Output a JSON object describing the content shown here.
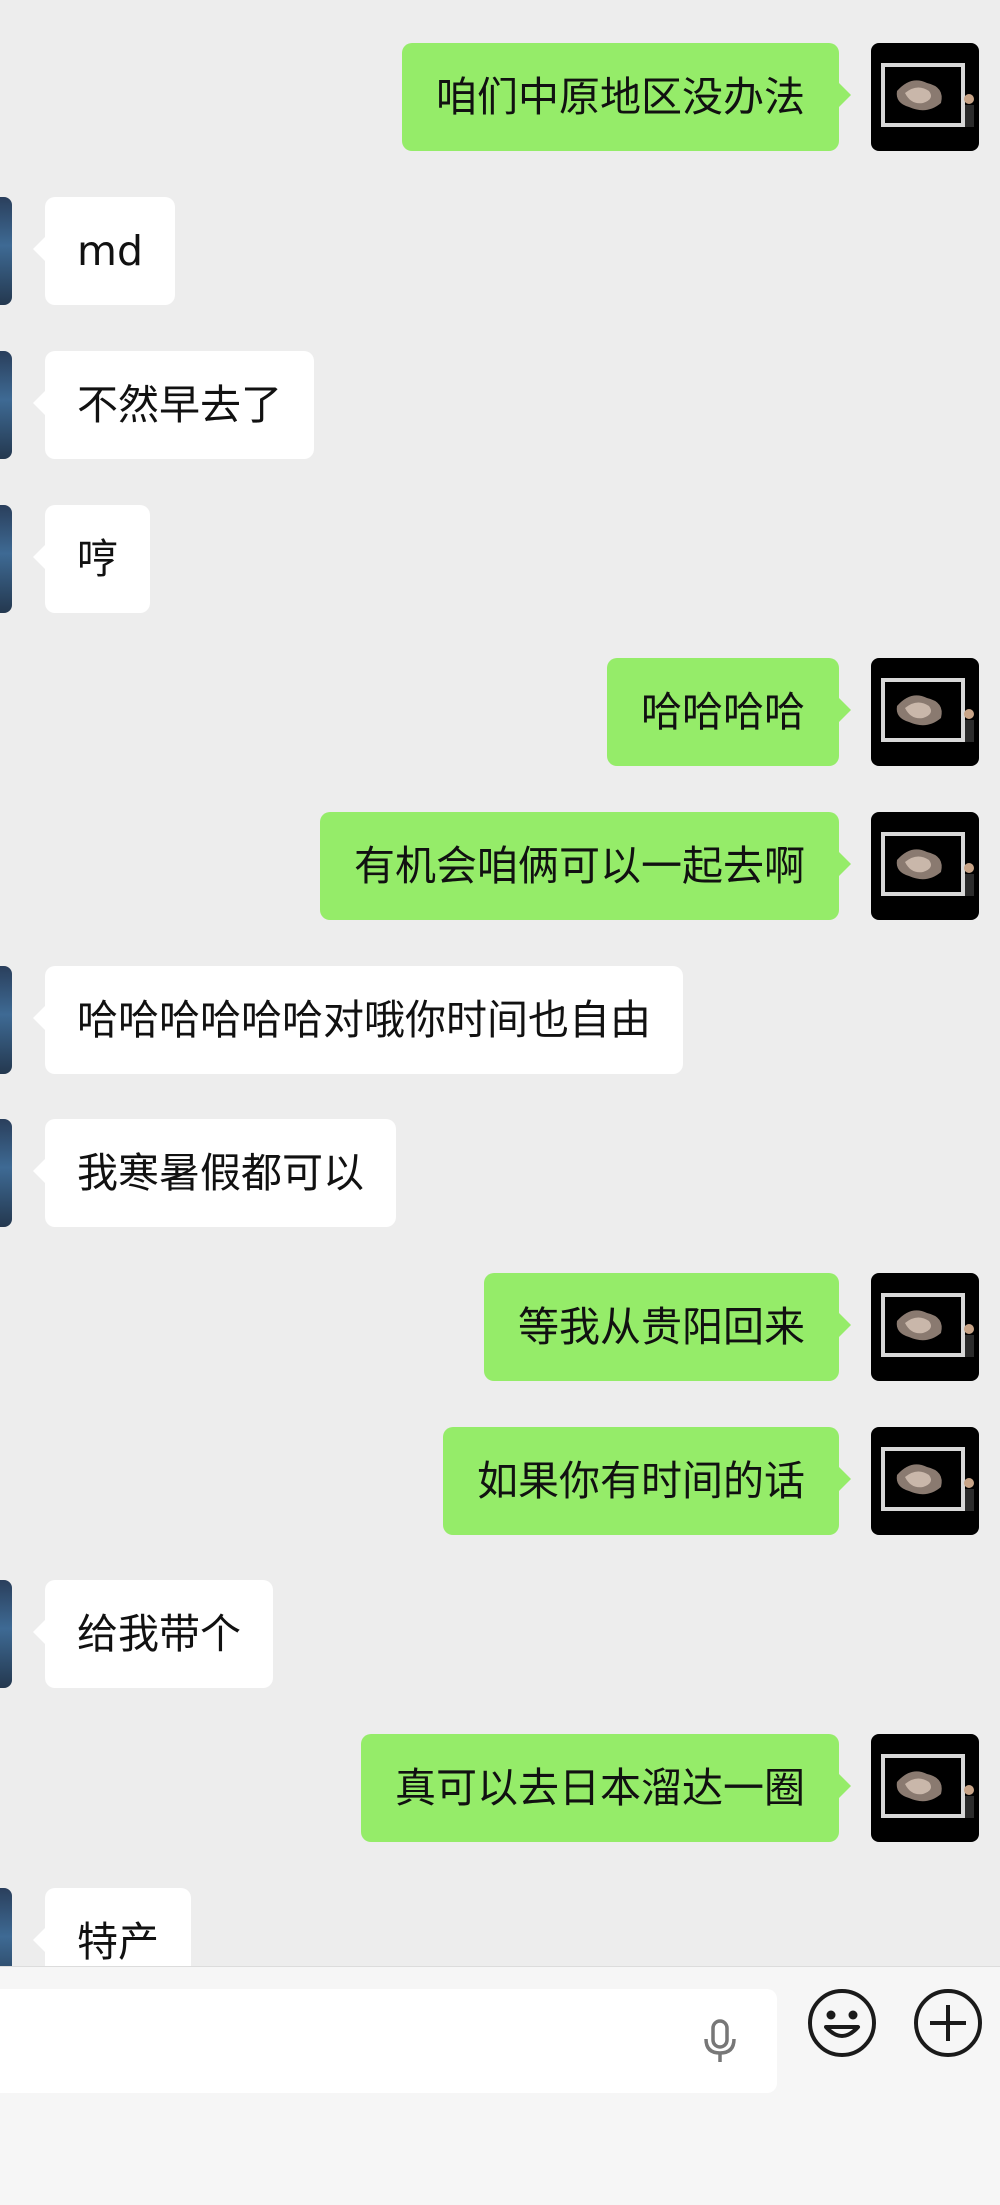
{
  "messages": [
    {
      "side": "out",
      "text": "咱们中原地区没办法"
    },
    {
      "side": "in",
      "text": "md"
    },
    {
      "side": "in",
      "text": "不然早去了"
    },
    {
      "side": "in",
      "text": "哼"
    },
    {
      "side": "out",
      "text": "哈哈哈哈"
    },
    {
      "side": "out",
      "text": "有机会咱俩可以一起去啊"
    },
    {
      "side": "in",
      "text": "哈哈哈哈哈哈对哦你时间也自由"
    },
    {
      "side": "in",
      "text": "我寒暑假都可以"
    },
    {
      "side": "out",
      "text": "等我从贵阳回来"
    },
    {
      "side": "out",
      "text": "如果你有时间的话"
    },
    {
      "side": "in",
      "text": "给我带个"
    },
    {
      "side": "out",
      "text": "真可以去日本溜达一圈"
    },
    {
      "side": "in",
      "text": "特产"
    }
  ],
  "input_bar": {
    "text_value": "",
    "mic_icon": "microphone-icon",
    "emoji_icon": "smiley-face-icon",
    "plus_icon": "plus-circle-icon"
  },
  "colors": {
    "background": "#ededed",
    "outgoing_bubble": "#95ec69",
    "incoming_bubble": "#ffffff"
  }
}
